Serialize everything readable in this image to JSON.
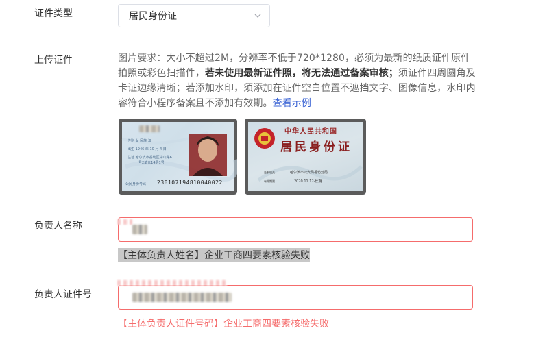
{
  "form": {
    "id_type": {
      "label": "证件类型",
      "selected": "居民身份证"
    },
    "upload": {
      "label": "上传证件",
      "req_prefix": "图片要求：大小不超过2M，分辨率不低于720*1280，必须为最新的纸质证件原件拍照或彩色扫描件，",
      "req_bold": "若未使用最新证件照，将无法通过备案审核；",
      "req_suffix": "须证件四周圆角及卡证边缘清晰；若添加水印，须添加在证件空白位置不遮挡文字、图像信息，水印内容符合小程序备案且不添加有效期。",
      "example_link": "查看示例",
      "front": {
        "name_line": "姓名",
        "gender_line": "性别 女  民族 汉",
        "birth_line": "出生 1946 年 10 月 4 日",
        "address_line1": "住址 哈尔滨市香坊区中山路61",
        "address_line2": "号2单元14层1号",
        "id_label": "公民身份号码",
        "id_number": "230107194810040022"
      },
      "back": {
        "country": "中华人民共和国",
        "title": "居民身份证",
        "authority_label": "签发机关",
        "authority": "哈尔滨市公安局香坊分局",
        "validity_label": "有效期限",
        "validity": "2020.11.12-长期"
      }
    },
    "owner_name": {
      "label": "负责人名称",
      "error": "【主体负责人姓名】企业工商四要素核验失败"
    },
    "owner_id": {
      "label": "负责人证件号",
      "error": "【主体负责人证件号码】企业工商四要素核验失败"
    }
  },
  "colors": {
    "error": "#f56c6c",
    "link": "#3a63d4",
    "border": "#dcdfe6"
  },
  "icons": {
    "select_arrow": "chevron-down-icon"
  }
}
